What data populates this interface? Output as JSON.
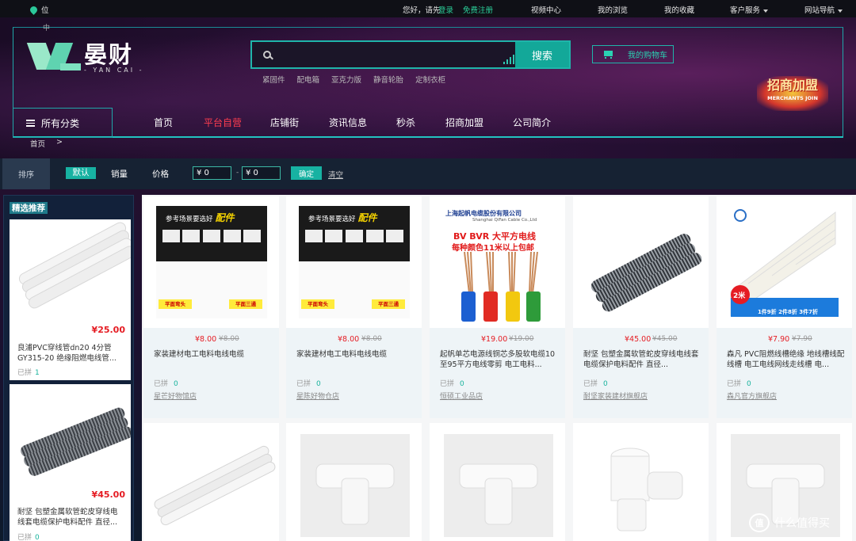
{
  "topbar": {
    "location": "位",
    "greeting": "您好，请先",
    "login": "登录",
    "register": "免费注册",
    "video_center": "视频中心",
    "my_browse": "我的浏览",
    "my_favorites": "我的收藏",
    "customer_service": "客户服务",
    "site_nav": "网站导航"
  },
  "header": {
    "logo_cn": "晏财",
    "logo_en": "- YAN CAI -",
    "search_placeholder": "",
    "search_button": "搜索",
    "hot_words": [
      "紧固件",
      "配电箱",
      "亚克力版",
      "静音轮胎",
      "定制衣柜"
    ],
    "cart": "我的购物车",
    "merchant_cn": "招商加盟",
    "merchant_en": "MERCHANTS JOIN",
    "all_categories": "所有分类",
    "nav": [
      "首页",
      "平台自营",
      "店铺街",
      "资讯信息",
      "秒杀",
      "招商加盟",
      "公司简介"
    ],
    "nav_active_index": 1,
    "breadcrumb": "首页",
    "frame_label": "中"
  },
  "filter": {
    "sort_label": "排序",
    "default": "默认",
    "sales": "销量",
    "price": "价格",
    "min_price": "¥ 0",
    "max_price": "¥ 0",
    "dash": "-",
    "confirm": "确定",
    "clear": "清空"
  },
  "sidebar": {
    "title": "精选推荐",
    "items": [
      {
        "price": "¥25.00",
        "name": "良浦PVC穿线管dn20 4分管GY315-20 绝缘阻燃电线管...",
        "sold_label": "已拼",
        "sold": "1",
        "image": "white-pipes"
      },
      {
        "price": "¥45.00",
        "name": "耐坚 包塑金属软管蛇皮穿线电线套电缆保护电料配件 直径...",
        "sold_label": "已拼",
        "sold": "0",
        "image": "metal-hose"
      }
    ]
  },
  "products": [
    {
      "price": "¥8.00",
      "old_price": "¥8.00",
      "name": "家装建材电工电料电线电缆",
      "sold_label": "已拼",
      "sold": "0",
      "shop": "星芒好物馆店",
      "image": "fittings-ad",
      "ad_title": "参考场景要选好",
      "ad_hl": "配件",
      "ad_l1": "平面弯头",
      "ad_l2": "平面三通"
    },
    {
      "price": "¥8.00",
      "old_price": "¥8.00",
      "name": "家装建材电工电料电线电缆",
      "sold_label": "已拼",
      "sold": "0",
      "shop": "星陈好物仓店",
      "image": "fittings-ad",
      "ad_title": "参考场景要选好",
      "ad_hl": "配件",
      "ad_l1": "平面弯头",
      "ad_l2": "平面三通"
    },
    {
      "price": "¥19.00",
      "old_price": "¥19.00",
      "name": "起帆单芯电源线铜芯多股软电缆10至95平方电线零剪 电工电料...",
      "sold_label": "已拼",
      "sold": "0",
      "shop": "恒硕工业品店",
      "image": "cable-ad",
      "ad_company": "上海起帆电缆股份有限公司",
      "ad_company_en": "Shanghai QiFan Cable Co.,Ltd",
      "ad_title": "BV BVR 大平方电线",
      "ad_sub": "每种颜色11米以上包邮"
    },
    {
      "price": "¥45.00",
      "old_price": "¥45.00",
      "name": "耐坚 包塑金属软管蛇皮穿线电线套电缆保护电料配件 直径...",
      "sold_label": "已拼",
      "sold": "0",
      "shop": "耐坚家装建材旗舰店",
      "image": "metal-hose"
    },
    {
      "price": "¥7.90",
      "old_price": "¥7.90",
      "name": "森凡 PVC阻燃线槽绝缘 地线槽线配线槽 电工电线网线走线槽 电...",
      "sold_label": "已拼",
      "sold": "0",
      "shop": "森凡官方旗舰店",
      "image": "trunking-ad",
      "ad_badge": "2米",
      "ad_banner": "1件9折 2件8折 3件7折"
    }
  ],
  "row2_images": [
    "white-pipes",
    "tee-fitting",
    "tee-fitting",
    "reducing-tee",
    "tee-fitting"
  ],
  "watermark": "什么值得买",
  "colors": {
    "accent": "#17b2a2",
    "price": "#e51c23",
    "nav_active": "#ff3d4f",
    "frame": "#1fa7a9"
  }
}
